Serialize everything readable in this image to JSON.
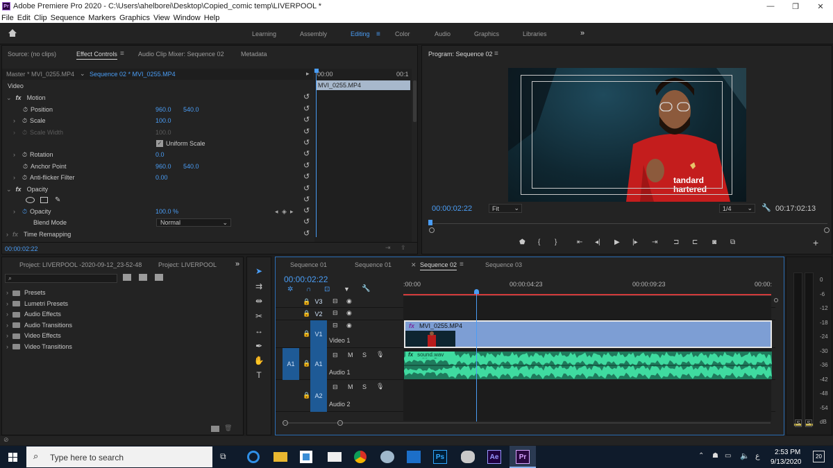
{
  "titlebar": {
    "title": "Adobe Premiere Pro 2020 - C:\\Users\\ahelborei\\Desktop\\Copied_comic temp\\LIVERPOOL  *",
    "logo": "Pr"
  },
  "menu": [
    "File",
    "Edit",
    "Clip",
    "Sequence",
    "Markers",
    "Graphics",
    "View",
    "Window",
    "Help"
  ],
  "workspaces": [
    "Learning",
    "Assembly",
    "Editing",
    "Color",
    "Audio",
    "Graphics",
    "Libraries"
  ],
  "workspace_active": "Editing",
  "source_panel": {
    "tabs": [
      "Source: (no clips)",
      "Effect Controls",
      "Audio Clip Mixer: Sequence 02",
      "Metadata"
    ],
    "master": "Master * MVI_0255.MP4",
    "sequence_clip": "Sequence 02 * MVI_0255.MP4",
    "time_start": "00:00",
    "time_end": "00:1",
    "clip_name": "MVI_0255.MP4",
    "video_label": "Video",
    "footer_time": "00:00:02:22",
    "props": {
      "motion": "Motion",
      "position": "Position",
      "position_x": "960.0",
      "position_y": "540.0",
      "scale": "Scale",
      "scale_val": "100.0",
      "scale_width": "Scale Width",
      "scale_width_val": "100.0",
      "uniform": "Uniform Scale",
      "rotation": "Rotation",
      "rotation_val": "0.0",
      "anchor": "Anchor Point",
      "anchor_x": "960.0",
      "anchor_y": "540.0",
      "antiflicker": "Anti-flicker Filter",
      "antiflicker_val": "0.00",
      "opacity_group": "Opacity",
      "opacity": "Opacity",
      "opacity_val": "100.0 %",
      "blend": "Blend Mode",
      "blend_val": "Normal",
      "time_remap": "Time Remapping"
    }
  },
  "program": {
    "title": "Program: Sequence 02",
    "timecode": "00:00:02:22",
    "fit": "Fit",
    "quality": "1/4",
    "duration": "00:17:02:13",
    "shirt_text_1": "tandard",
    "shirt_text_2": "hartered"
  },
  "project": {
    "tab1": "Project: LIVERPOOL -2020-09-12_23-52-48",
    "tab2": "Project: LIVERPOOL",
    "items": [
      "Presets",
      "Lumetri Presets",
      "Audio Effects",
      "Audio Transitions",
      "Video Effects",
      "Video Transitions"
    ]
  },
  "timeline": {
    "tabs": [
      "Sequence 01",
      "Sequence 01",
      "Sequence 02",
      "Sequence 03"
    ],
    "active_tab": "Sequence 02",
    "timecode": "00:00:02:22",
    "ruler": [
      ":00:00",
      "00:00:04:23",
      "00:00:09:23",
      "00:00:"
    ],
    "tracks": {
      "v3": "V3",
      "v2": "V2",
      "v1": "V1",
      "video1": "Video 1",
      "a1_src": "A1",
      "a1": "A1",
      "audio1": "Audio 1",
      "a2": "A2",
      "audio2": "Audio 2"
    },
    "video_clip": "MVI_0255.MP4",
    "audio_clip": "sound.wav",
    "m": "M",
    "s": "S"
  },
  "meter": {
    "labels": [
      "0",
      "-6",
      "-12",
      "-18",
      "-24",
      "-30",
      "-36",
      "-42",
      "-48",
      "-54",
      "dB"
    ],
    "solo": [
      "S",
      "S"
    ]
  },
  "taskbar": {
    "search": "Type here to search",
    "time": "2:53 PM",
    "date": "9/13/2020",
    "lang": "ع",
    "notif": "20",
    "apps": [
      "Ps",
      "Ae",
      "Pr"
    ]
  },
  "colors": {
    "accent": "#4a9df5",
    "audio_green": "#2fbf8c",
    "video_clip": "#7d9ed4",
    "playhead": "#4a9df5",
    "work_area": "#d23a3a"
  }
}
